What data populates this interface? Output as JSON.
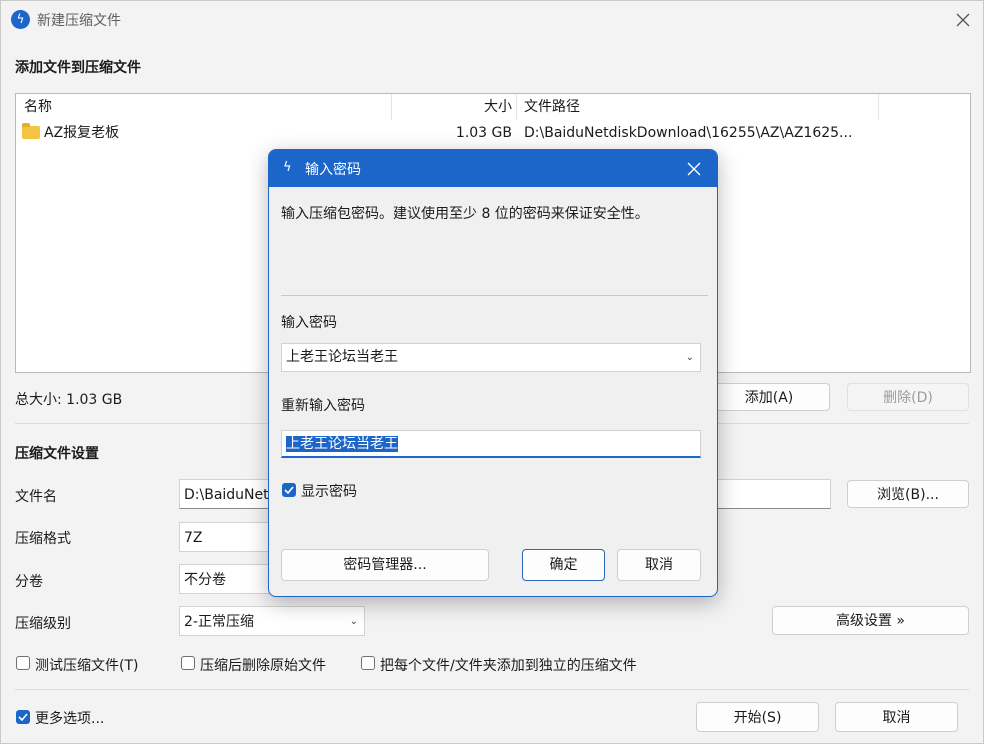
{
  "window": {
    "title": "新建压缩文件"
  },
  "files_section": {
    "title": "添加文件到压缩文件",
    "columns": [
      "名称",
      "大小",
      "文件路径"
    ],
    "rows": [
      {
        "name": "AZ报复老板",
        "size": "1.03 GB",
        "path": "D:\\BaiduNetdiskDownload\\16255\\AZ\\AZ1625..."
      }
    ],
    "total_size": "总大小: 1.03 GB",
    "add_button": "添加(A)",
    "delete_button": "删除(D)"
  },
  "settings": {
    "title": "压缩文件设置",
    "filename_label": "文件名",
    "filename_value": "D:\\BaiduNet",
    "browse_button": "浏览(B)...",
    "format_label": "压缩格式",
    "format_value": "7Z",
    "volume_label": "分卷",
    "volume_value": "不分卷",
    "level_label": "压缩级别",
    "level_value": "2-正常压缩",
    "advanced_button": "高级设置 »",
    "test_checkbox": "测试压缩文件(T)",
    "delete_after_checkbox": "压缩后删除原始文件",
    "each_separate_checkbox": "把每个文件/文件夹添加到独立的压缩文件",
    "more_options_checkbox": "更多选项...",
    "start_button": "开始(S)",
    "cancel_button": "取消"
  },
  "password_dialog": {
    "title": "输入密码",
    "description": "输入压缩包密码。建议使用至少 8 位的密码来保证安全性。",
    "password_label": "输入密码",
    "password_value": "上老王论坛当老王",
    "confirm_label": "重新输入密码",
    "confirm_value": "上老王论坛当老王",
    "show_password": "显示密码",
    "manager_button": "密码管理器...",
    "ok_button": "确定",
    "cancel_button": "取消"
  },
  "colors": {
    "accent": "#1d66c9",
    "window_bg": "#f3f3f3"
  }
}
